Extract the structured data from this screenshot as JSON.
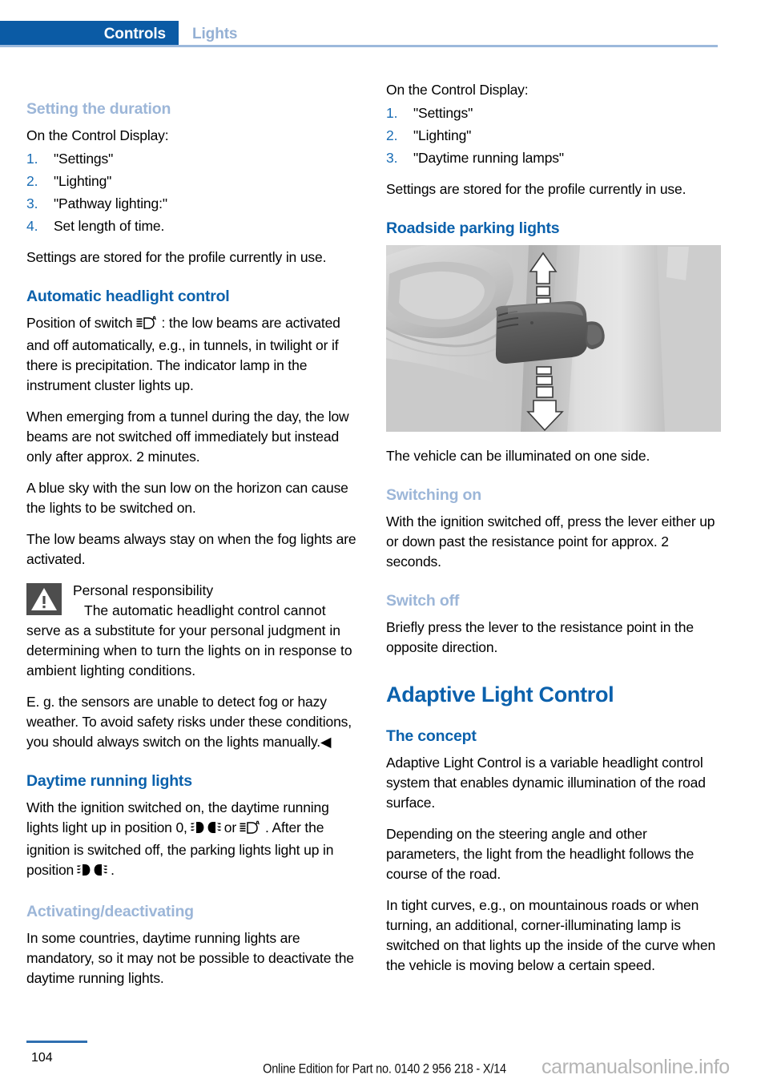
{
  "header": {
    "active_tab": "Controls",
    "inactive_tab": "Lights",
    "active_tab_color": "#0b5ba5",
    "inactive_tab_color": "#94b0d4",
    "rule_color": "#9cb9dc"
  },
  "colors": {
    "heading_blue": "#0b61ac",
    "subheading_blue": "#9cb6d8",
    "list_number_blue": "#1a6db5",
    "warning_box": "#4d4d4d",
    "watermark_gray": "#b4b4b4"
  },
  "left_column": {
    "h3_setting_duration": "Setting the duration",
    "p_on_control_display": "On the Control Display:",
    "steps_duration": [
      {
        "num": "1.",
        "text": "\"Settings\""
      },
      {
        "num": "2.",
        "text": "\"Lighting\""
      },
      {
        "num": "3.",
        "text": "\"Pathway lighting:\""
      },
      {
        "num": "4.",
        "text": "Set length of time."
      }
    ],
    "p_settings_stored": "Settings are stored for the profile currently in use.",
    "h2_automatic_headlight_control": "Automatic headlight control",
    "p_position_of_switch_pre": "Position of switch",
    "p_position_of_switch_post": ": the low beams are activated and off automatically, e.g., in tunnels, in twilight or if there is precipitation. The indicator lamp in the instrument cluster lights up.",
    "p_tunnel": "When emerging from a tunnel during the day, the low beams are not switched off immediately but instead only after approx. 2 minutes.",
    "p_blue_sky": "A blue sky with the sun low on the horizon can cause the lights to be switched on.",
    "p_fog_lights": "The low beams always stay on when the fog lights are activated.",
    "warning": {
      "icon_name": "warning-triangle-icon",
      "title": "Personal responsibility",
      "body_1": "The automatic headlight control cannot serve as a substitute for your personal judgment in determining when to turn the lights on in response to ambient lighting conditions.",
      "body_2": "E. g. the sensors are unable to detect fog or hazy weather. To avoid safety risks under these conditions, you should always switch on the lights manually.",
      "end_marker": "◀"
    },
    "h2_daytime_running_lights": "Daytime running lights",
    "p_daytime_1": "With the ignition switched on, the daytime running lights light up in position 0,",
    "p_daytime_or": "or",
    "p_daytime_2": ". After the ignition is switched off, the parking lights light up in position",
    "p_daytime_3": ".",
    "h3_activating_deactivating": "Activating/deactivating",
    "p_activating_body": "In some countries, daytime running lights are mandatory, so it may not be possible to deactivate the daytime running lights."
  },
  "right_column": {
    "p_on_control_display": "On the Control Display:",
    "steps_daytime": [
      {
        "num": "1.",
        "text": "\"Settings\""
      },
      {
        "num": "2.",
        "text": "\"Lighting\""
      },
      {
        "num": "3.",
        "text": "\"Daytime running lamps\""
      }
    ],
    "p_settings_stored": "Settings are stored for the profile currently in use.",
    "h2_roadside_parking_lights": "Roadside parking lights",
    "figure_alt": "turn-signal-stalk-lever-illustration",
    "p_vehicle_illuminated": "The vehicle can be illuminated on one side.",
    "h3_switching_on": "Switching on",
    "p_switching_on_body": "With the ignition switched off, press the lever either up or down past the resistance point for approx. 2 seconds.",
    "h3_switch_off": "Switch off",
    "p_switch_off_body": "Briefly press the lever to the resistance point in the opposite direction.",
    "h1_adaptive_light_control": "Adaptive Light Control",
    "h2_the_concept": "The concept",
    "p_concept_1": "Adaptive Light Control is a variable headlight control system that enables dynamic illumination of the road surface.",
    "p_concept_2": "Depending on the steering angle and other parameters, the light from the headlight follows the course of the road.",
    "p_concept_3": "In tight curves, e.g., on mountainous roads or when turning, an additional, corner-illuminating lamp is switched on that lights up the inside of the curve when the vehicle is moving below a certain speed."
  },
  "footer": {
    "page_number": "104",
    "edition_text": "Online Edition for Part no. 0140 2 956 218 - X/14",
    "watermark": "carmanualsonline.info"
  },
  "icons": {
    "auto_headlight": "auto-headlight-icon",
    "parking_lights": "parking-lights-icon"
  }
}
